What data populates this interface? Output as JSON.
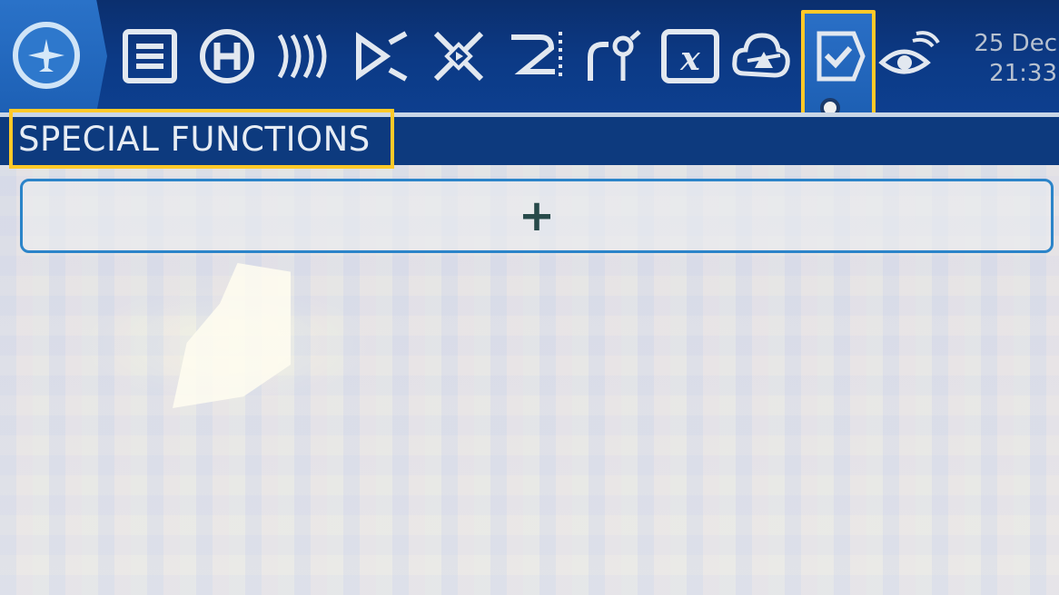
{
  "header": {
    "date": "25 Dec",
    "time": "21:33",
    "icons": [
      {
        "name": "model-home-icon"
      },
      {
        "name": "model-setup-list-icon"
      },
      {
        "name": "heli-setup-icon"
      },
      {
        "name": "flight-modes-icon"
      },
      {
        "name": "inputs-icon"
      },
      {
        "name": "mixes-icon"
      },
      {
        "name": "outputs-icon"
      },
      {
        "name": "curves-icon"
      },
      {
        "name": "global-variables-icon"
      },
      {
        "name": "logical-switches-icon"
      },
      {
        "name": "special-functions-icon",
        "selected": true
      },
      {
        "name": "telemetry-icon"
      }
    ]
  },
  "page": {
    "title": "SPECIAL FUNCTIONS",
    "add_label": "+"
  },
  "colors": {
    "topbar": "#0c3a86",
    "highlight": "#ffc928",
    "accent": "#2b84c9"
  }
}
